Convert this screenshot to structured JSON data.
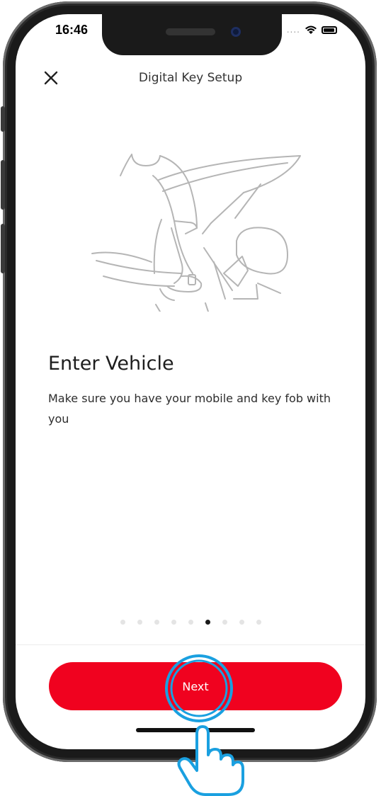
{
  "status_bar": {
    "time": "16:46"
  },
  "nav": {
    "title": "Digital Key Setup",
    "close_icon": "close-icon"
  },
  "illustration": {
    "icon": "person-entering-car-illustration"
  },
  "content": {
    "heading": "Enter Vehicle",
    "body": "Make sure you have your mobile and key fob with you"
  },
  "pager": {
    "total": 9,
    "current": 6
  },
  "footer": {
    "next_label": "Next"
  },
  "colors": {
    "accent": "#f0021f",
    "tap_highlight": "#1aa0e0"
  }
}
